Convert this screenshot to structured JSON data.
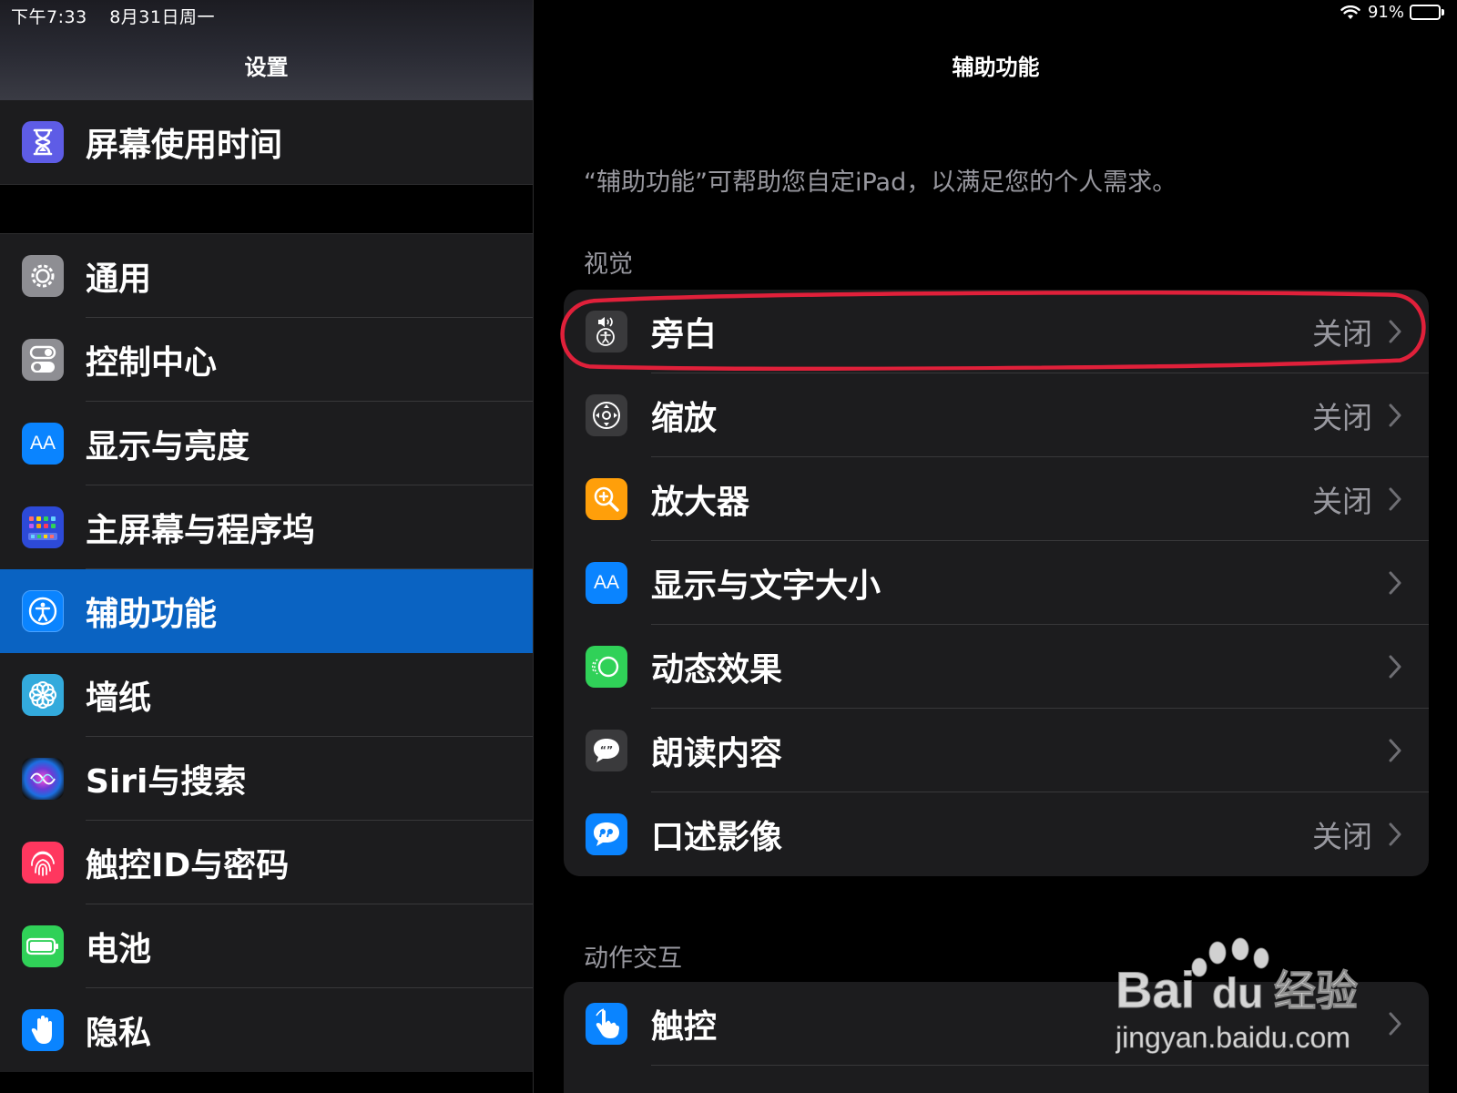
{
  "status_bar": {
    "time": "下午7:33",
    "date": "8月31日周一",
    "battery_percent": "91%",
    "battery_level": 0.91,
    "battery_color": "#34c759"
  },
  "sidebar": {
    "title": "设置",
    "items": [
      {
        "label": "屏幕使用时间",
        "icon": "hourglass-icon",
        "color": "#5e5ce6"
      },
      {
        "label": "通用",
        "icon": "gear-icon",
        "color": "#8e8e93"
      },
      {
        "label": "控制中心",
        "icon": "toggles-icon",
        "color": "#8e8e93"
      },
      {
        "label": "显示与亮度",
        "icon": "text-size-icon",
        "color": "#0a84ff",
        "glyph": "AA"
      },
      {
        "label": "主屏幕与程序坞",
        "icon": "home-screen-grid-icon",
        "color": "#2d4ad8"
      },
      {
        "label": "辅助功能",
        "icon": "accessibility-icon",
        "color": "#0a84ff",
        "selected": true
      },
      {
        "label": "墙纸",
        "icon": "flower-icon",
        "color": "#33aadc"
      },
      {
        "label": "Siri与搜索",
        "icon": "siri-icon",
        "color": "#1c1c1e"
      },
      {
        "label": "触控ID与密码",
        "icon": "fingerprint-icon",
        "color": "#ff375f"
      },
      {
        "label": "电池",
        "icon": "battery-icon",
        "color": "#30d158"
      },
      {
        "label": "隐私",
        "icon": "hand-icon",
        "color": "#0a84ff"
      }
    ]
  },
  "main": {
    "title": "辅助功能",
    "description": "“辅助功能”可帮助您自定iPad，以满足您的个人需求。",
    "sections": [
      {
        "header": "视觉",
        "rows": [
          {
            "label": "旁白",
            "value": "关闭",
            "icon": "voiceover-icon",
            "color": "#3a3a3c"
          },
          {
            "label": "缩放",
            "value": "关闭",
            "icon": "zoom-icon",
            "color": "#3a3a3c"
          },
          {
            "label": "放大器",
            "value": "关闭",
            "icon": "magnifier-icon",
            "color": "#ff9f0a"
          },
          {
            "label": "显示与文字大小",
            "value": "",
            "icon": "text-size-icon",
            "color": "#0a84ff",
            "glyph": "AA"
          },
          {
            "label": "动态效果",
            "value": "",
            "icon": "motion-icon",
            "color": "#30d158"
          },
          {
            "label": "朗读内容",
            "value": "",
            "icon": "speech-bubble-icon",
            "color": "#3a3a3c"
          },
          {
            "label": "口述影像",
            "value": "关闭",
            "icon": "audio-description-icon",
            "color": "#0a84ff"
          }
        ]
      },
      {
        "header": "动作交互",
        "rows": [
          {
            "label": "触控",
            "value": "",
            "icon": "touch-hand-icon",
            "color": "#0a84ff"
          }
        ]
      }
    ]
  },
  "annotation": {
    "color": "#e0203a"
  },
  "watermark": {
    "brand": "Bai",
    "brand2": "du",
    "cn": "经验",
    "url": "jingyan.baidu.com"
  }
}
